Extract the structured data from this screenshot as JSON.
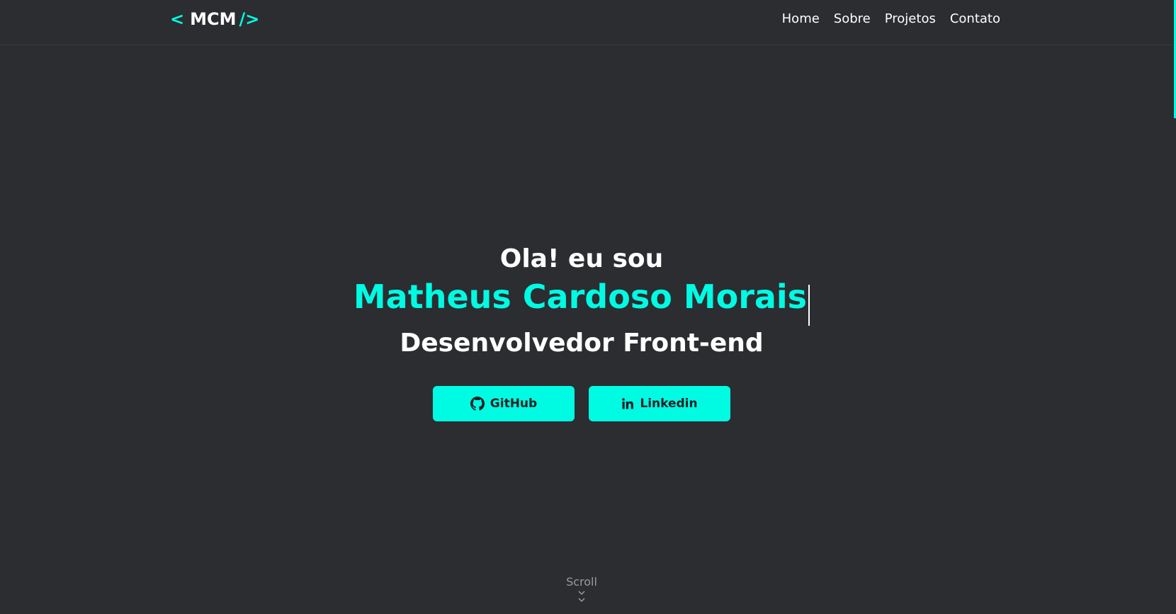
{
  "header": {
    "logo": {
      "open": "<",
      "name": "MCM",
      "close": "/>"
    },
    "nav": [
      {
        "label": "Home"
      },
      {
        "label": "Sobre"
      },
      {
        "label": "Projetos"
      },
      {
        "label": "Contato"
      }
    ]
  },
  "hero": {
    "greeting": "Ola! eu sou",
    "name": "Matheus Cardoso Morais",
    "role": "Desenvolvedor Front-end"
  },
  "buttons": {
    "github": {
      "label": "GitHub",
      "icon": "github-icon"
    },
    "linkedin": {
      "label": "Linkedin",
      "icon": "linkedin-icon"
    }
  },
  "scroll": {
    "label": "Scroll"
  },
  "colors": {
    "background": "#2c2d31",
    "accent": "#00fbe3",
    "text": "#ffffff"
  }
}
